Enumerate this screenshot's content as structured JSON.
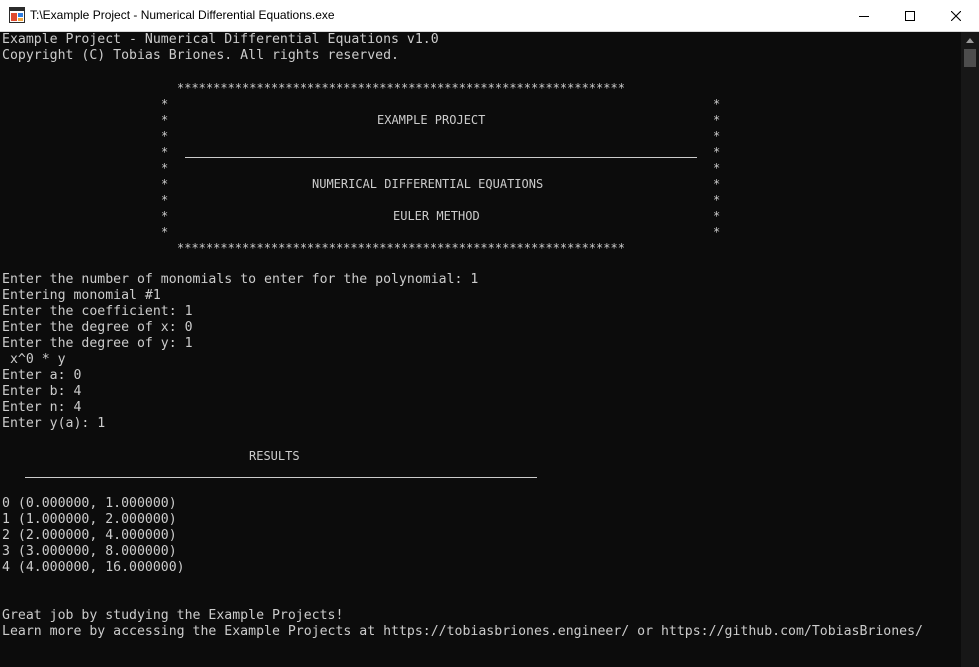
{
  "window": {
    "title": "T:\\Example Project - Numerical Differential Equations.exe"
  },
  "console": {
    "header": [
      "Example Project - Numerical Differential Equations v1.0",
      "Copyright (C) Tobias Briones. All rights reserved."
    ],
    "banner": {
      "border": "**************************************************************",
      "star": "*",
      "project": "EXAMPLE PROJECT",
      "subtitle": "NUMERICAL DIFFERENTIAL EQUATIONS",
      "method": "EULER METHOD"
    },
    "input_lines": [
      "Enter the number of monomials to enter for the polynomial: 1",
      "Entering monomial #1",
      "Enter the coefficient: 1",
      "Enter the degree of x: 0",
      "Enter the degree of y: 1",
      " x^0 * y",
      "Enter a: 0",
      "Enter b: 4",
      "Enter n: 4",
      "Enter y(a): 1"
    ],
    "results_title": "RESULTS",
    "results": [
      "0 (0.000000, 1.000000)",
      "1 (1.000000, 2.000000)",
      "2 (2.000000, 4.000000)",
      "3 (3.000000, 8.000000)",
      "4 (4.000000, 16.000000)"
    ],
    "footer": [
      "Great job by studying the Example Projects!",
      "Learn more by accessing the Example Projects at https://tobiasbriones.engineer/ or https://github.com/TobiasBriones/"
    ]
  }
}
